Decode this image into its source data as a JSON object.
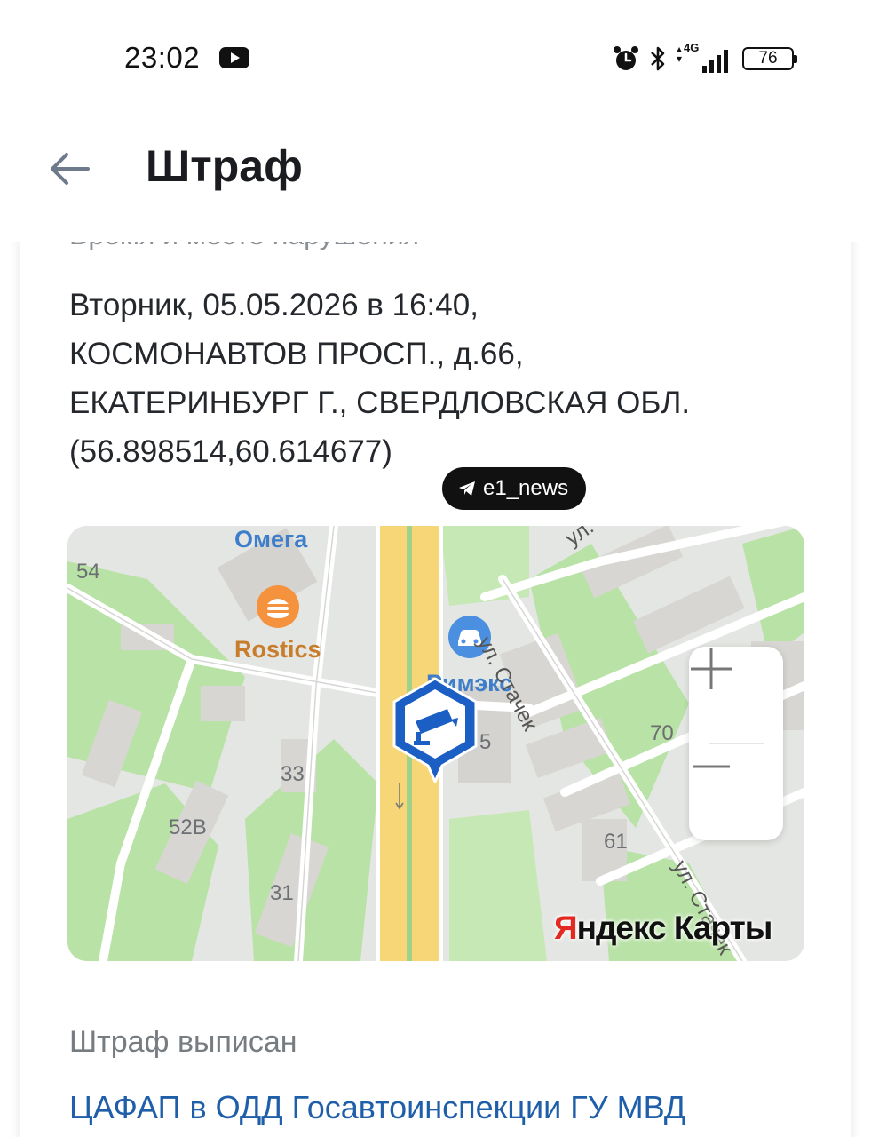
{
  "status_bar": {
    "time": "23:02",
    "network": "4G",
    "battery": "76",
    "icons": [
      "youtube-icon",
      "alarm-icon",
      "bluetooth-icon",
      "signal-icon",
      "battery-icon"
    ]
  },
  "header": {
    "title": "Штраф",
    "back_icon": "arrow-left-icon"
  },
  "violation": {
    "section_label": "Время и место нарушения",
    "details": "Вторник, 05.05.2026 в 16:40,\nКОСМОНАВТОВ ПРОСП., д.66,\nЕКАТЕРИНБУРГ Г., СВЕРДЛОВСКАЯ ОБЛ.\n(56.898514,60.614677)"
  },
  "watermark": {
    "text": "e1_news",
    "icon": "telegram-icon"
  },
  "map": {
    "poi": {
      "omega": "Омега",
      "rostics": "Rostics",
      "rimex": "Римэкс"
    },
    "streets": {
      "stachek": "ул. Стачек",
      "stachek_lower": "ул. Стачек",
      "top_right": "ул."
    },
    "house_numbers": {
      "h54": "54",
      "h33": "33",
      "h52v": "52В",
      "h31": "31",
      "h70": "70",
      "h61": "61",
      "h5": "5"
    },
    "zoom_in": "+",
    "zoom_out": "−",
    "logo_red": "Я",
    "logo_rest": "ндекс Карты",
    "marker_icon": "traffic-camera-icon"
  },
  "issued": {
    "label": "Штраф выписан",
    "issuer": "ЦАФАП в ОДД Госавтоинспекции ГУ МВД"
  },
  "colors": {
    "accent_blue": "#1f5ea8",
    "marker_blue": "#1b5fc4",
    "map_green": "#b9e2a6",
    "road_yellow": "#f6d676",
    "logo_red": "#e22a22"
  }
}
